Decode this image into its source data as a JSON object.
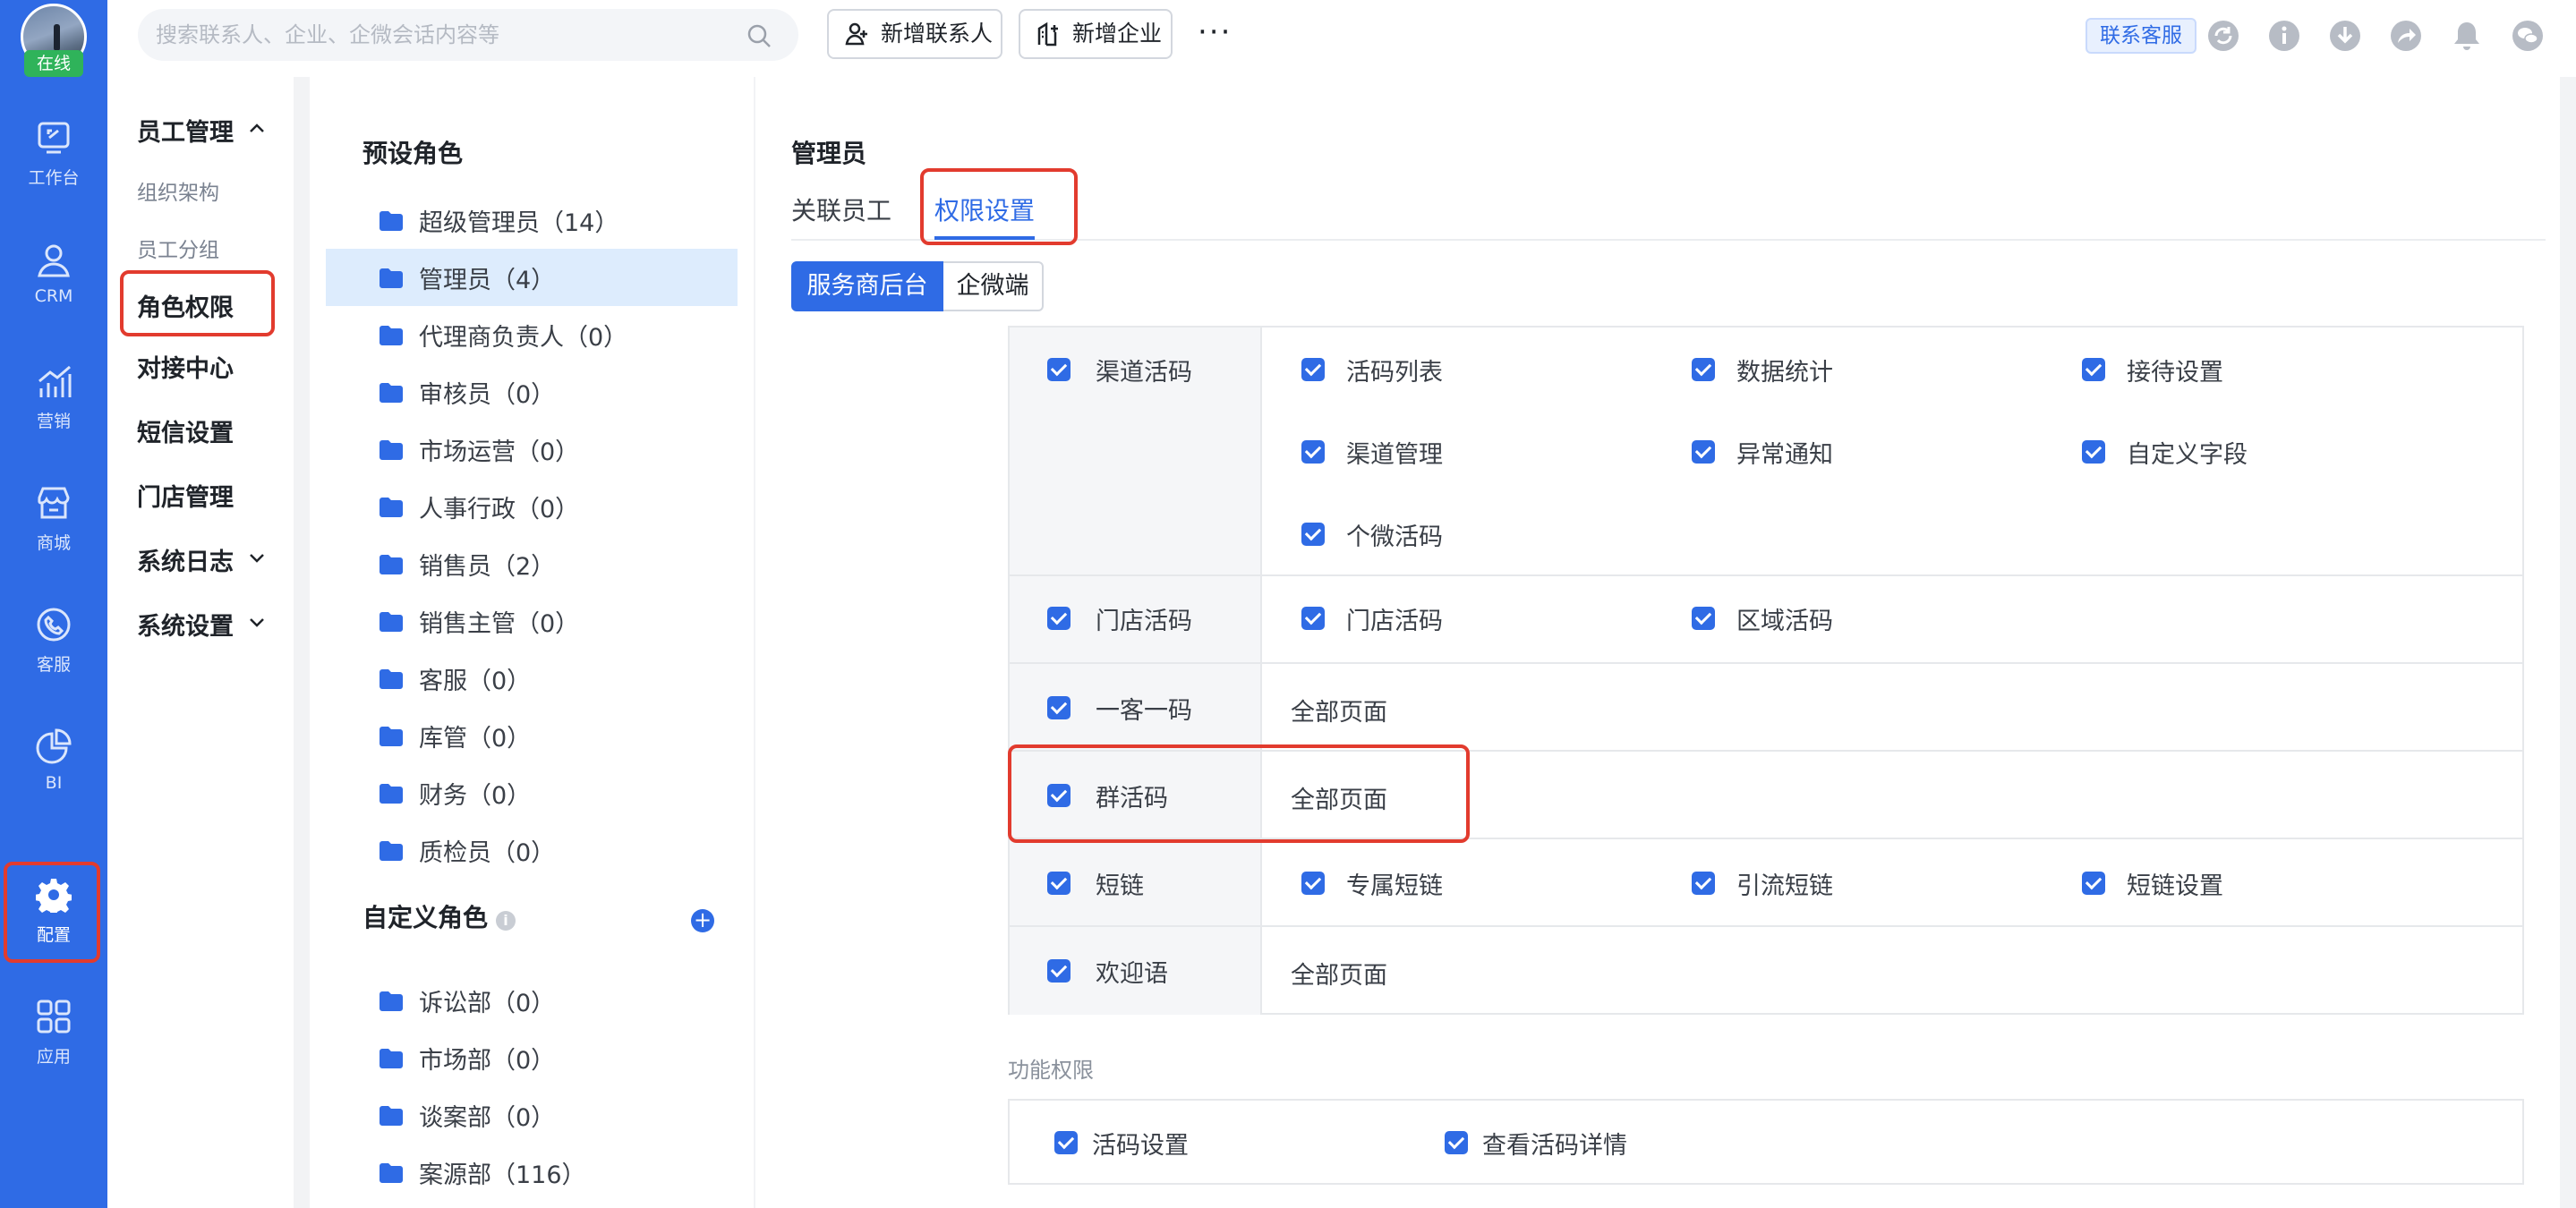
{
  "rail": {
    "status": "在线",
    "items": [
      {
        "label": "工作台",
        "icon": "workbench-icon"
      },
      {
        "label": "CRM",
        "icon": "crm-user-icon"
      },
      {
        "label": "营销",
        "icon": "marketing-chart-icon"
      },
      {
        "label": "商城",
        "icon": "store-icon"
      },
      {
        "label": "客服",
        "icon": "phone-service-icon"
      },
      {
        "label": "BI",
        "icon": "pie-chart-icon"
      },
      {
        "label": "配置",
        "icon": "gear-icon"
      },
      {
        "label": "应用",
        "icon": "apps-grid-icon"
      }
    ],
    "active": "配置"
  },
  "topbar": {
    "search_placeholder": "搜索联系人、企业、企微会话内容等",
    "add_contact": "新增联系人",
    "add_company": "新增企业",
    "more": "···",
    "service": "联系客服"
  },
  "subnav": {
    "group_title": "员工管理",
    "sub_items": [
      "组织架构",
      "员工分组"
    ],
    "items": [
      "角色权限",
      "对接中心",
      "短信设置",
      "门店管理"
    ],
    "collapsible": [
      "系统日志",
      "系统设置"
    ],
    "active": "角色权限"
  },
  "roles": {
    "preset_title": "预设角色",
    "preset": [
      "超级管理员（14）",
      "管理员（4）",
      "代理商负责人（0）",
      "审核员（0）",
      "市场运营（0）",
      "人事行政（0）",
      "销售员（2）",
      "销售主管（0）",
      "客服（0）",
      "库管（0）",
      "财务（0）",
      "质检员（0）"
    ],
    "selected": "管理员（4）",
    "custom_title": "自定义角色",
    "custom": [
      "诉讼部（0）",
      "市场部（0）",
      "谈案部（0）",
      "案源部（116）"
    ]
  },
  "main": {
    "title": "管理员",
    "tabs": [
      "关联员工",
      "权限设置"
    ],
    "active_tab": "权限设置",
    "segments": [
      "服务商后台",
      "企微端"
    ],
    "rows": [
      {
        "name": "渠道活码",
        "perms": [
          "活码列表",
          "数据统计",
          "接待设置",
          "渠道管理",
          "异常通知",
          "自定义字段",
          "个微活码"
        ]
      },
      {
        "name": "门店活码",
        "perms": [
          "门店活码",
          "区域活码"
        ]
      },
      {
        "name": "一客一码",
        "perms": [],
        "all": "全部页面"
      },
      {
        "name": "群活码",
        "perms": [],
        "all": "全部页面"
      },
      {
        "name": "短链",
        "perms": [
          "专属短链",
          "引流短链",
          "短链设置"
        ]
      },
      {
        "name": "欢迎语",
        "perms": [],
        "all": "全部页面"
      }
    ],
    "func_label": "功能权限",
    "func_perms": [
      "活码设置",
      "查看活码详情"
    ]
  },
  "colors": {
    "primary": "#2f6be5",
    "highlight": "#e23b2e",
    "rail": "#2f6be5"
  }
}
